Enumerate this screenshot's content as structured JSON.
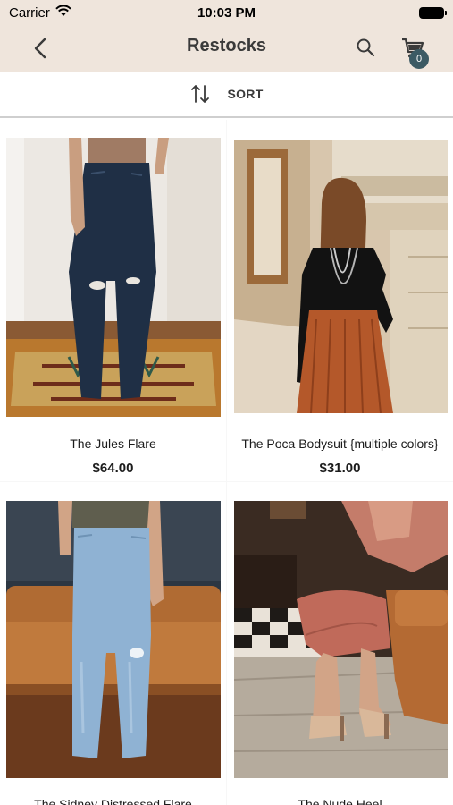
{
  "status": {
    "carrier": "Carrier",
    "time": "10:03 PM"
  },
  "nav": {
    "title": "Restocks",
    "cart_count": "0"
  },
  "sort": {
    "label": "SORT"
  },
  "products": [
    {
      "name": "The Jules Flare",
      "price": "$64.00"
    },
    {
      "name": "The Poca Bodysuit {multiple colors}",
      "price": "$31.00"
    },
    {
      "name": "The Sidney Distressed Flare",
      "price": ""
    },
    {
      "name": "The Nude Heel",
      "price": ""
    }
  ],
  "colors": {
    "header_bg": "#efe5dc",
    "badge": "#3c5a64"
  }
}
